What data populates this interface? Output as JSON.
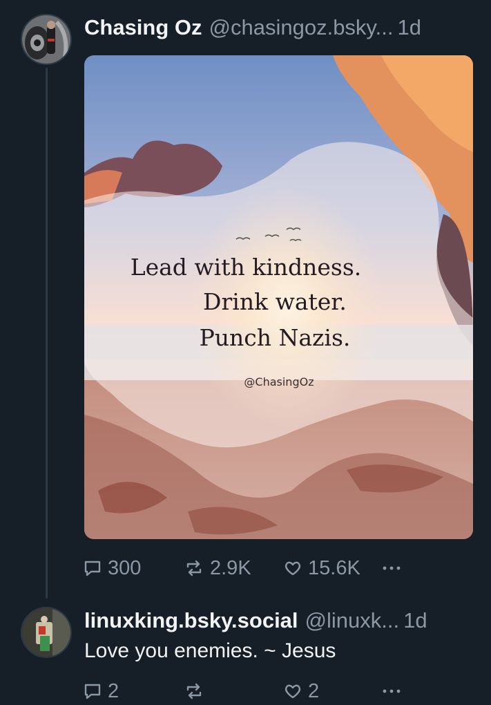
{
  "posts": [
    {
      "author": {
        "display_name": "Chasing Oz",
        "handle": "@chasingoz.bsky...",
        "timestamp": "1d"
      },
      "image": {
        "quote_lines": [
          "Lead with kindness.",
          "Drink water.",
          "Punch Nazis."
        ],
        "watermark": "@ChasingOz"
      },
      "stats": {
        "replies": "300",
        "reposts": "2.9K",
        "likes": "15.6K"
      }
    },
    {
      "author": {
        "display_name": "linuxking.bsky.social",
        "handle": "@linuxk...",
        "timestamp": "1d"
      },
      "text": "Love you enemies. ~ Jesus",
      "stats": {
        "replies": "2",
        "reposts": "",
        "likes": "2"
      }
    }
  ],
  "icons": {
    "reply": "speech-bubble-icon",
    "repost": "repost-arrows-icon",
    "like": "heart-icon",
    "more": "ellipsis-icon"
  },
  "colors": {
    "background": "#161e27",
    "text_primary": "#f1f3f5",
    "text_secondary": "#8b98a5",
    "thread_line": "#2d3a48"
  }
}
